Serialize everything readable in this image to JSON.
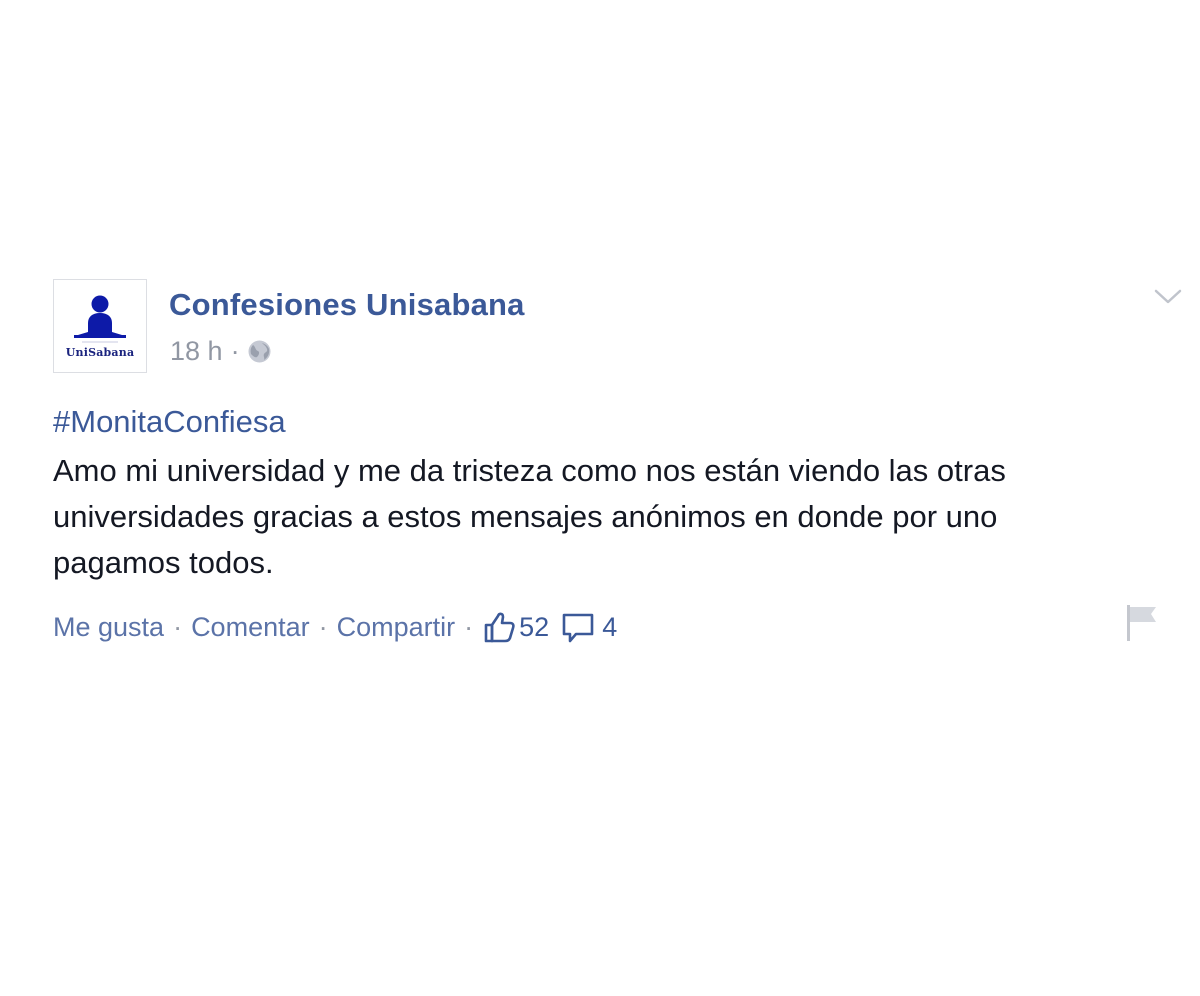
{
  "post": {
    "page_name": "Confesiones Unisabana",
    "avatar_label": "UniSabana",
    "timestamp": "18 h",
    "meta_separator": "·",
    "privacy_icon": "globe-icon",
    "menu_icon": "chevron-down-icon",
    "hashtag": "#MonitaConfiesa",
    "body_lines": [
      "Amo mi universidad y me da tristeza como nos están viendo las otras",
      "universidades gracias a estos mensajes anónimos en donde por uno",
      "pagamos todos."
    ]
  },
  "actions": {
    "like_label": "Me gusta",
    "comment_label": "Comentar",
    "share_label": "Compartir",
    "separator": "·",
    "like_count": "52",
    "comment_count": "4",
    "like_icon": "thumbs-up-icon",
    "comment_icon": "speech-bubble-icon",
    "report_icon": "flag-icon"
  },
  "colors": {
    "link": "#3b5998",
    "secondary_link": "#5b73a8",
    "meta_gray": "#9197a3",
    "body_text": "#141823",
    "avatar_navy": "#1a237e"
  }
}
